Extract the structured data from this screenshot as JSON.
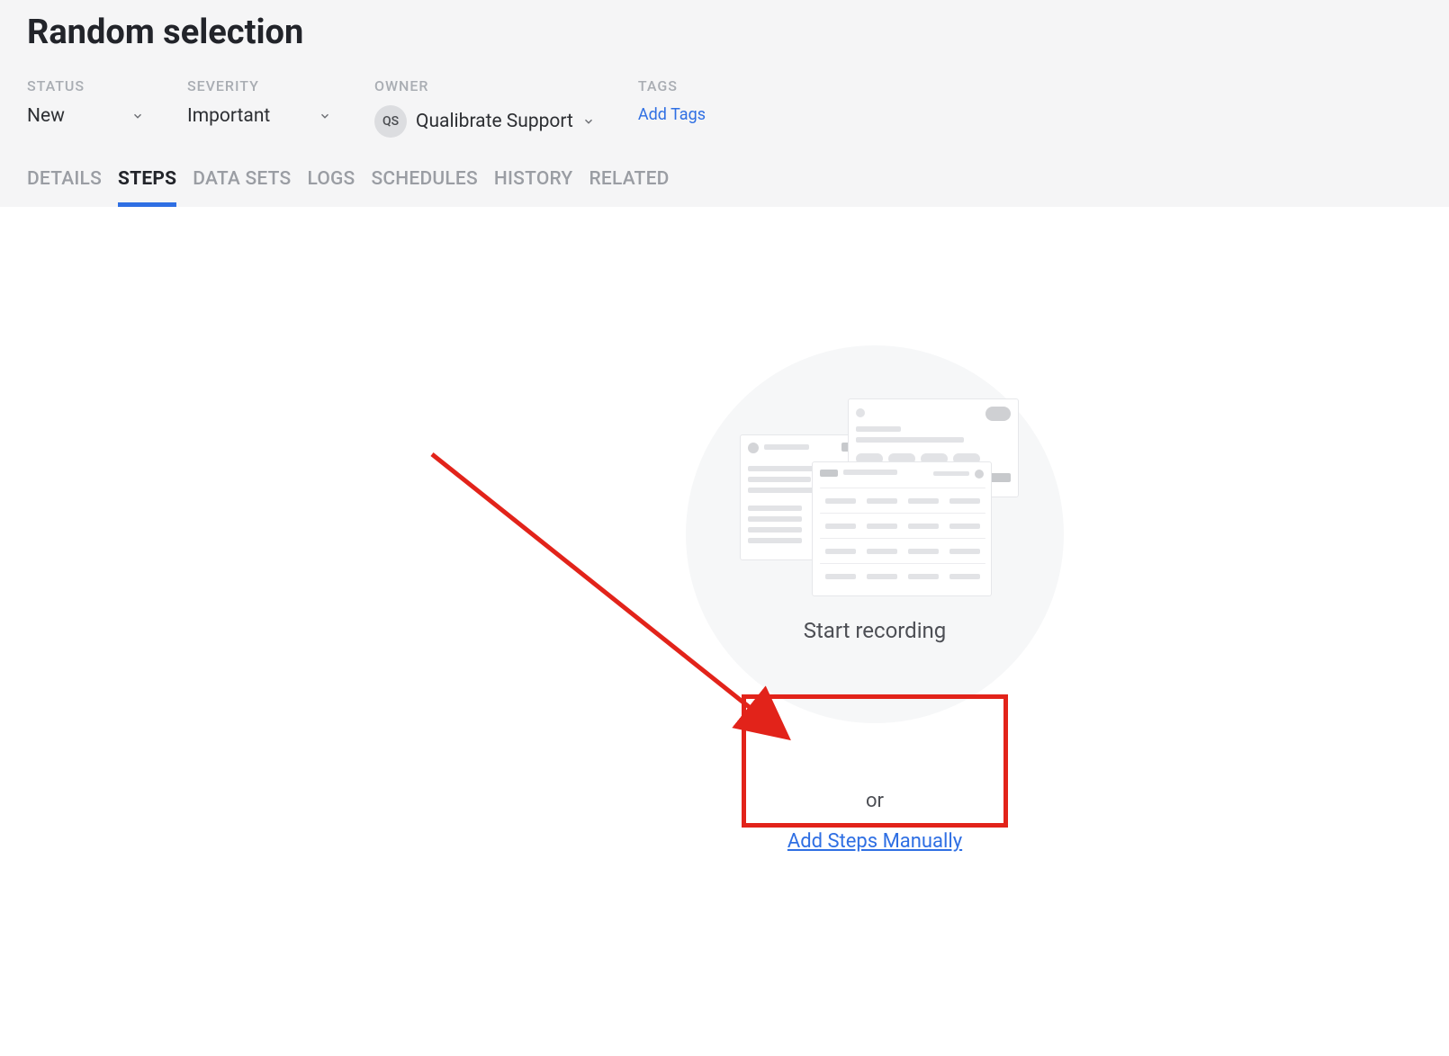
{
  "page": {
    "title": "Random selection"
  },
  "meta": {
    "status_label": "STATUS",
    "status_value": "New",
    "severity_label": "SEVERITY",
    "severity_value": "Important",
    "owner_label": "OWNER",
    "owner_initials": "QS",
    "owner_value": "Qualibrate Support",
    "tags_label": "TAGS",
    "add_tags": "Add Tags"
  },
  "tabs": {
    "details": "DETAILS",
    "steps": "STEPS",
    "datasets": "DATA SETS",
    "logs": "LOGS",
    "schedules": "SCHEDULES",
    "history": "HISTORY",
    "related": "RELATED"
  },
  "empty": {
    "start": "Start recording",
    "or": "or",
    "manual": "Add Steps Manually"
  }
}
